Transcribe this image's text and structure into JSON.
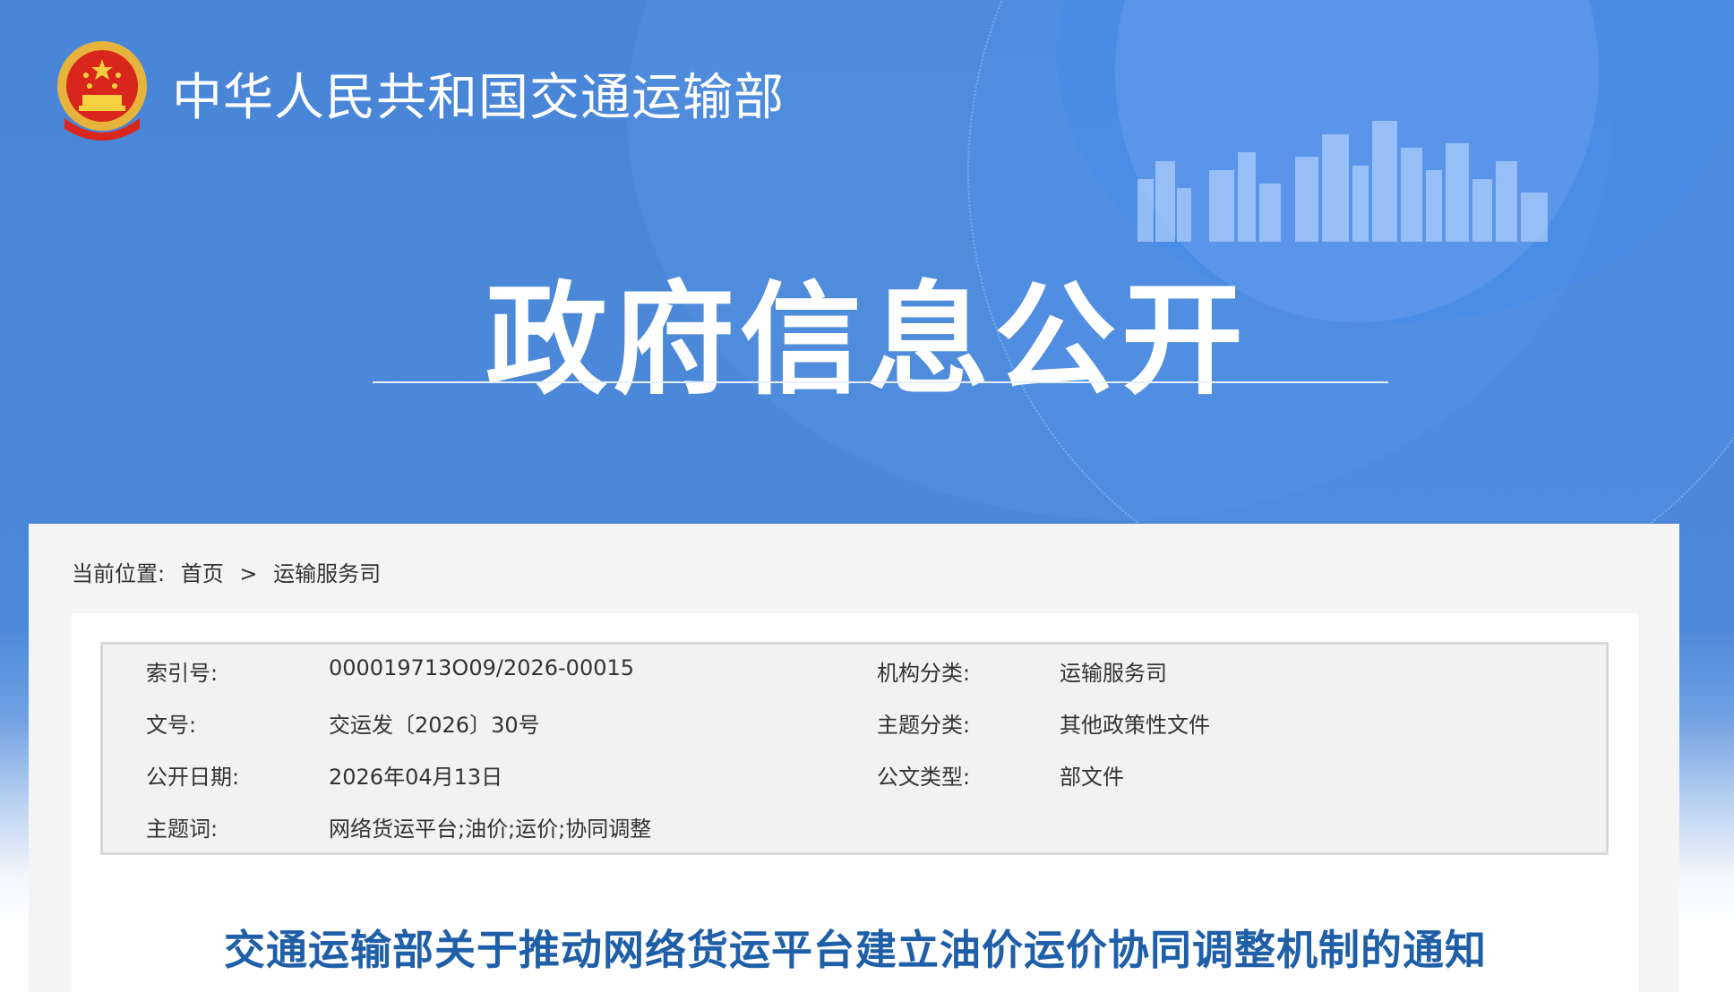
{
  "site": {
    "title": "中华人民共和国交通运输部"
  },
  "section": {
    "title": "政府信息公开"
  },
  "breadcrumb": {
    "prefix": "当前位置:",
    "home": "首页",
    "separator": ">",
    "current": "运输服务司"
  },
  "meta": {
    "index_label": "索引号:",
    "index_value": "000019713O09/2026-00015",
    "org_label": "机构分类:",
    "org_value": "运输服务司",
    "docno_label": "文号:",
    "docno_value": "交运发〔2026〕30号",
    "topic_label": "主题分类:",
    "topic_value": "其他政策性文件",
    "date_label": "公开日期:",
    "date_value": "2026年04月13日",
    "doctype_label": "公文类型:",
    "doctype_value": "部文件",
    "keywords_label": "主题词:",
    "keywords_value": "网络货运平台;油价;运价;协同调整"
  },
  "article": {
    "title": "交通运输部关于推动网络货运平台建立油价运价协同调整机制的通知"
  },
  "colors": {
    "banner_blue": "#4a86d8",
    "title_blue": "#1f5fa8",
    "panel_gray": "#f4f4f4"
  },
  "icons": {
    "emblem": "national-emblem-icon"
  }
}
